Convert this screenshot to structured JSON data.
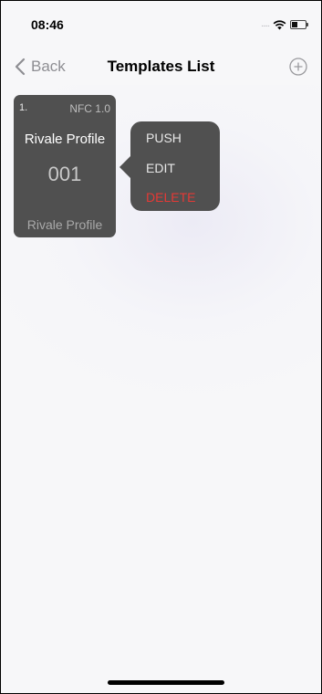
{
  "status_bar": {
    "time": "08:46",
    "signal": "....."
  },
  "nav": {
    "back_label": "Back",
    "title": "Templates List"
  },
  "templates": [
    {
      "index": "1.",
      "version": "NFC 1.0",
      "name": "Rivale Profile",
      "code": "001",
      "footer": "Rivale Profile"
    }
  ],
  "context_menu": {
    "push": "PUSH",
    "edit": "EDIT",
    "delete": "DELETE"
  },
  "colors": {
    "card_bg": "#505050",
    "delete_red": "#e53935",
    "nav_bg": "#f7f7f9"
  },
  "icons": [
    "chevron-left-icon",
    "add-circle-icon",
    "wifi-icon",
    "battery-icon"
  ]
}
